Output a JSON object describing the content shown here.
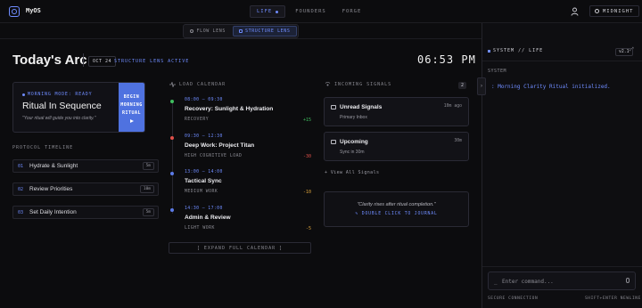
{
  "app": {
    "brand": "MyOS"
  },
  "nav": {
    "items": [
      {
        "label": "LIFE",
        "active": true
      },
      {
        "label": "FOUNDERS",
        "active": false
      },
      {
        "label": "FORGE",
        "active": false
      }
    ]
  },
  "theme": {
    "label": "MIDNIGHT"
  },
  "lens": {
    "flow": "FLOW LENS",
    "structure": "STRUCTURE LENS",
    "active_label": "STRUCTURE LENS ACTIVE"
  },
  "header": {
    "title": "Today's Arc",
    "date": "OCT 24",
    "clock": "06:53 PM"
  },
  "mode": {
    "label": "MORNING MODE: READY",
    "title": "Ritual In Sequence",
    "subtitle": "\"Your ritual will guide you into clarity.\"",
    "button_line1": "BEGIN",
    "button_line2": "MORNING",
    "button_line3": "RITUAL"
  },
  "protocol": {
    "heading": "PROTOCOL TIMELINE",
    "items": [
      {
        "num": "01",
        "label": "Hydrate & Sunlight",
        "dur": "5m"
      },
      {
        "num": "02",
        "label": "Review Priorities",
        "dur": "10m"
      },
      {
        "num": "03",
        "label": "Set Daily Intention",
        "dur": "5m"
      }
    ]
  },
  "calendar": {
    "heading": "LOAD CALENDAR",
    "items": [
      {
        "time": "08:00 — 09:30",
        "title": "Recovery: Sunlight & Hydration",
        "type": "RECOVERY",
        "score": "+15",
        "dot": "#3fbf5f",
        "score_color": "#3fbf5f"
      },
      {
        "time": "09:30 — 12:30",
        "title": "Deep Work: Project Titan",
        "type": "HIGH COGNITIVE LOAD",
        "score": "-30",
        "dot": "#e0504a",
        "score_color": "#e0504a"
      },
      {
        "time": "13:00 — 14:00",
        "title": "Tactical Sync",
        "type": "MEDIUM WORK",
        "score": "-10",
        "dot": "#5b7be8",
        "score_color": "#e0a63c"
      },
      {
        "time": "14:30 — 17:00",
        "title": "Admin & Review",
        "type": "LIGHT WORK",
        "score": "-5",
        "dot": "#5b7be8",
        "score_color": "#e0a63c"
      }
    ],
    "expand": "[ EXPAND FULL CALENDAR ]"
  },
  "signals": {
    "heading": "INCOMING SIGNALS",
    "count": "2",
    "items": [
      {
        "title": "Unread Signals",
        "sub": "Primary Inbox",
        "time": "10m ago"
      },
      {
        "title": "Upcoming",
        "sub": "Sync in 30m",
        "time": "30m"
      }
    ],
    "view_all": "+ View All Signals",
    "quote": "\"Clarity rises after ritual completion.\"",
    "quote_action": "DOUBLE CLICK TO JOURNAL"
  },
  "system": {
    "heading": "SYSTEM // LIFE",
    "version": "v2.1",
    "label": "SYSTEM",
    "log": ": Morning Clarity Ritual initialized.",
    "prompt": "_",
    "placeholder": "Enter command...",
    "footer_left": "SECURE CONNECTION",
    "footer_right": "SHIFT+ENTER NEWLINE"
  },
  "colors": {
    "accent": "#6f8cff",
    "button": "#4f72e0",
    "bg": "#0c0c0e"
  }
}
